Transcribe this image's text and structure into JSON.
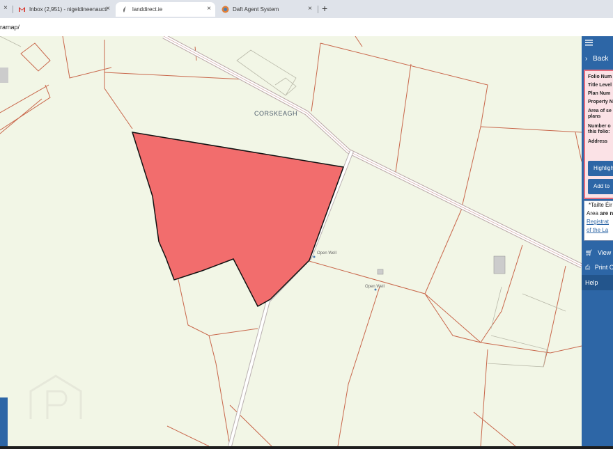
{
  "browser": {
    "tabs": [
      {
        "label": "Inbox (2,951) - nigeldineenaucti",
        "icon": "gmail-icon"
      },
      {
        "label": "landdirect.ie",
        "icon": "landdirect-icon"
      },
      {
        "label": "Daft Agent System",
        "icon": "daft-icon"
      }
    ],
    "new_tab": "+",
    "close": "×",
    "url_fragment": "ramap/"
  },
  "map": {
    "townland_label": "CORSKEAGH",
    "features": [
      "Open Well",
      "Open Well"
    ],
    "colors": {
      "background": "#f2f6e6",
      "boundary": "#c8664a",
      "parcel_fill": "#f26d6d",
      "road": "#b9a6a6"
    },
    "watermark": "P"
  },
  "sidebar": {
    "menu_icon": "hamburger-icon",
    "back_label": "Back",
    "folio_fields": [
      "Folio Num",
      "Title Level",
      "Plan Num",
      "Property N",
      "Area of se",
      "plans",
      "Number o",
      "this folio:",
      "Address"
    ],
    "highlight_button": "Highligh",
    "add_button": "Add to",
    "note": {
      "line1": "*Tailte Éir",
      "line2_prefix": "Area ",
      "line2_bold": "are n",
      "link1": "Registrat",
      "link2": "of the La"
    },
    "view_label": "View E",
    "print_label": "Print C",
    "help_label": "Help",
    "colors": {
      "bar": "#2d66a6",
      "panel_bg": "#fbe2e6",
      "panel_border": "#e36b7c"
    }
  }
}
